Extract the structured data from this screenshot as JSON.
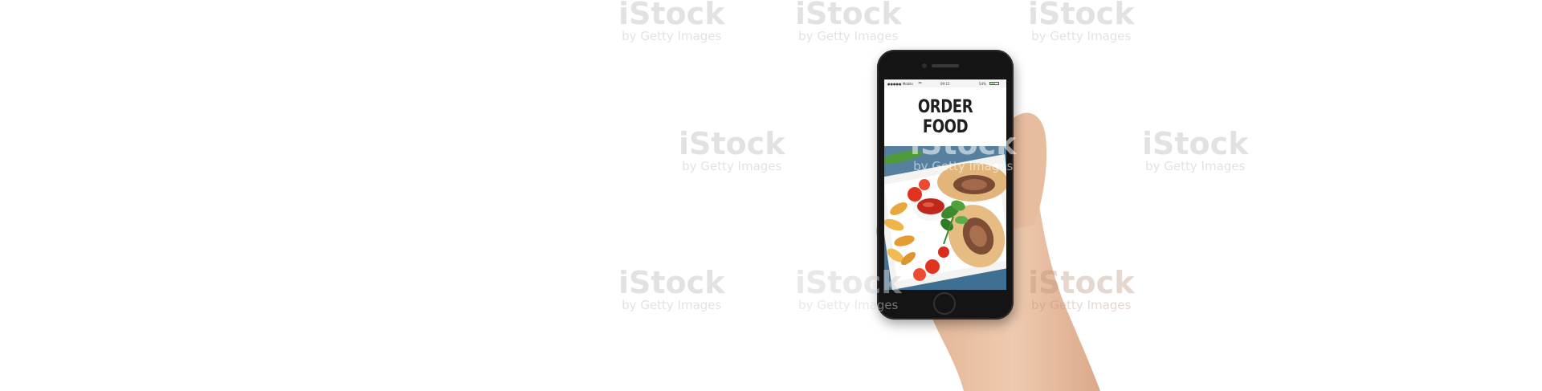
{
  "screen": {
    "title": "ORDER FOOD",
    "status": {
      "carrier": "●●●●● Mobile",
      "time": "09:15",
      "battery_label": "54%",
      "battery_level": 0.54
    }
  },
  "watermark": {
    "brand": "iStock",
    "sub": "by Getty Images"
  },
  "colors": {
    "background": "#ffffff",
    "phone_body": "#141414",
    "skin": "#ecc4a6",
    "plate_table": "#3f6f93",
    "title_text": "#1f1f1f"
  },
  "icons": [
    "wifi-icon",
    "battery-icon",
    "home-button-icon"
  ]
}
